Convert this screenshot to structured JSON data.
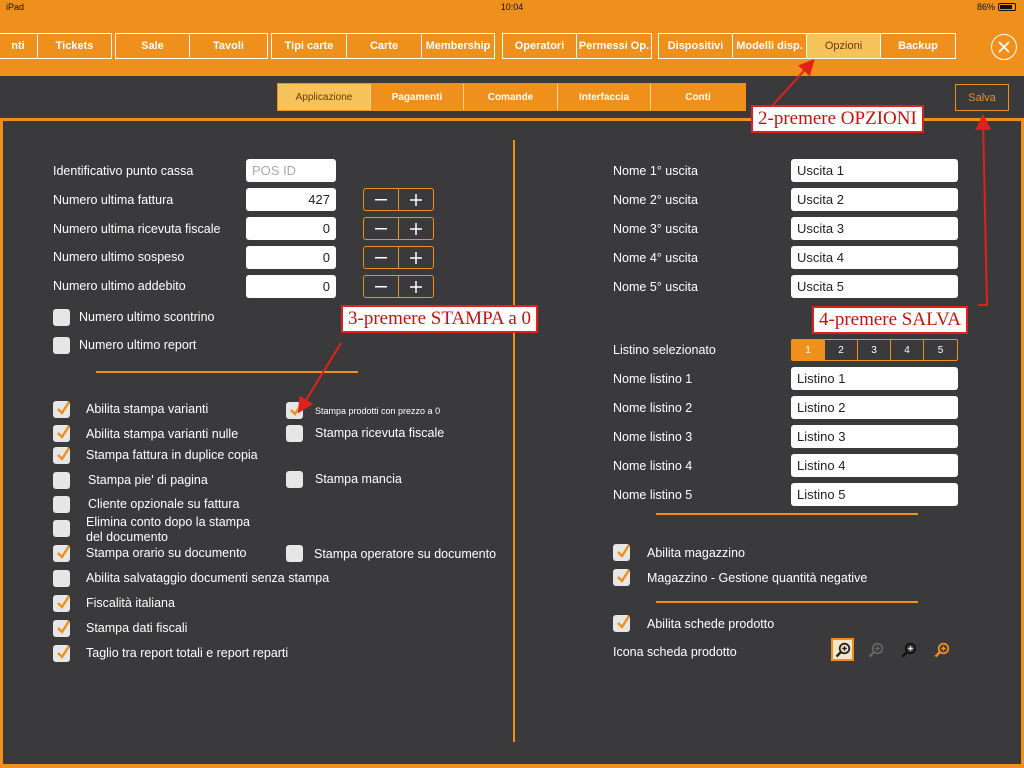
{
  "status_bar": {
    "device": "iPad",
    "time": "10:04",
    "battery": "86%"
  },
  "top_tabs": {
    "groups": [
      [
        "nti",
        "Tickets"
      ],
      [
        "Sale",
        "Tavoli"
      ],
      [
        "Tipi carte",
        "Carte",
        "Membership"
      ],
      [
        "Operatori",
        "Permessi Op."
      ],
      [
        "Dispositivi",
        "Modelli disp.",
        "Opzioni",
        "Backup"
      ]
    ],
    "active": "Opzioni"
  },
  "sub_tabs": {
    "items": [
      "Applicazione",
      "Pagamenti",
      "Comande",
      "Interfaccia",
      "Conti"
    ],
    "active": "Applicazione"
  },
  "save_button": "Salva",
  "left": {
    "pos_id_label": "Identificativo punto cassa",
    "pos_id_placeholder": "POS ID",
    "counters": [
      {
        "label": "Numero ultima fattura",
        "value": "427"
      },
      {
        "label": "Numero ultima ricevuta fiscale",
        "value": "0"
      },
      {
        "label": "Numero ultimo sospeso",
        "value": "0"
      },
      {
        "label": "Numero ultimo addebito",
        "value": "0"
      }
    ],
    "reset_checks": [
      "Numero ultimo scontrino",
      "Numero ultimo report"
    ],
    "options": [
      {
        "label": "Abilita stampa varianti",
        "checked": true
      },
      {
        "label": "Stampa prodotti con prezzo a 0",
        "checked": true
      },
      {
        "label": "Abilita stampa varianti nulle",
        "checked": true
      },
      {
        "label": "Stampa ricevuta fiscale",
        "checked": false
      },
      {
        "label": "Stampa fattura in duplice copia",
        "checked": true
      },
      {
        "label": "Stampa pie' di pagina",
        "checked": false
      },
      {
        "label": "Stampa mancia",
        "checked": false
      },
      {
        "label": "Cliente opzionale su fattura",
        "checked": false
      },
      {
        "label": "Elimina conto dopo la stampa del documento",
        "line1": "Elimina conto dopo la stampa",
        "line2": "del documento",
        "checked": false
      },
      {
        "label": "Stampa orario su documento",
        "checked": true
      },
      {
        "label": "Stampa operatore su documento",
        "checked": false
      },
      {
        "label": "Abilita salvataggio documenti senza stampa",
        "checked": false
      },
      {
        "label": "Fiscalità italiana",
        "checked": true
      },
      {
        "label": "Stampa dati fiscali",
        "checked": true
      },
      {
        "label": "Taglio tra report totali e report reparti",
        "checked": true
      }
    ]
  },
  "right": {
    "exits": [
      {
        "label": "Nome 1° uscita",
        "value": "Uscita 1"
      },
      {
        "label": "Nome 2° uscita",
        "value": "Uscita 2"
      },
      {
        "label": "Nome 3° uscita",
        "value": "Uscita 3"
      },
      {
        "label": "Nome 4° uscita",
        "value": "Uscita 4"
      },
      {
        "label": "Nome 5° uscita",
        "value": "Uscita 5"
      }
    ],
    "listino_label": "Listino selezionato",
    "listino_options": [
      "1",
      "2",
      "3",
      "4",
      "5"
    ],
    "listino_selected": "1",
    "listini": [
      {
        "label": "Nome listino 1",
        "value": "Listino 1"
      },
      {
        "label": "Nome listino 2",
        "value": "Listino 2"
      },
      {
        "label": "Nome listino 3",
        "value": "Listino 3"
      },
      {
        "label": "Nome listino 4",
        "value": "Listino 4"
      },
      {
        "label": "Nome listino 5",
        "value": "Listino 5"
      }
    ],
    "magazzino": [
      {
        "label": "Abilita magazzino",
        "checked": true
      },
      {
        "label": "Magazzino - Gestione quantità negative",
        "checked": true
      }
    ],
    "schede": {
      "label": "Abilita schede prodotto",
      "checked": true
    },
    "icon_label": "Icona scheda prodotto",
    "icon_options": [
      "zoom-in-icon",
      "zoom-in-icon",
      "zoom-in-icon",
      "zoom-in-icon"
    ]
  },
  "annotations": {
    "step2": "2-premere OPZIONI",
    "step3": "3-premere STAMPA a 0",
    "step4": "4-premere SALVA"
  },
  "colors": {
    "accent": "#f0901c",
    "background": "#3a3a3c",
    "annotation": "#e0211b"
  }
}
